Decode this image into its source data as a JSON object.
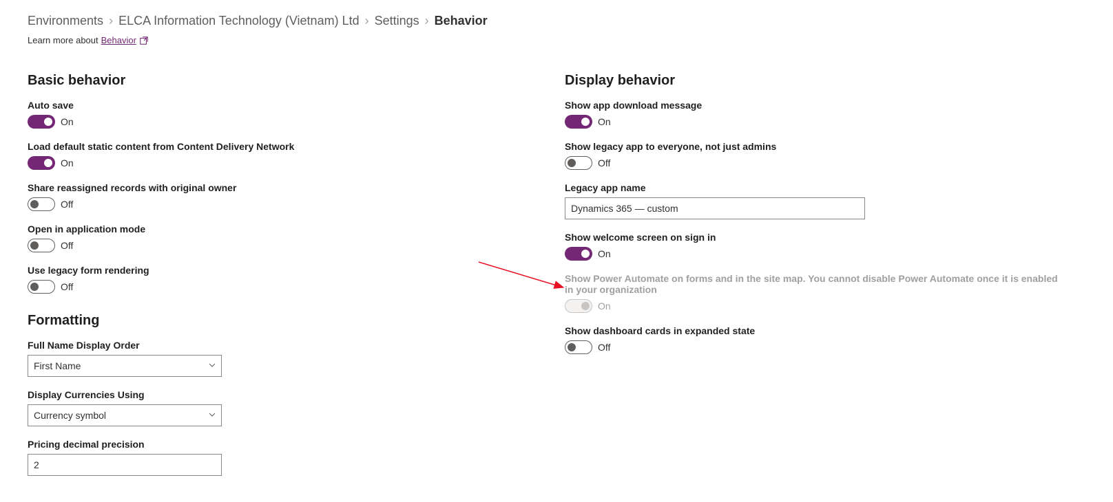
{
  "breadcrumb": {
    "items": [
      "Environments",
      "ELCA Information Technology (Vietnam) Ltd",
      "Settings"
    ],
    "current": "Behavior"
  },
  "learn_more": {
    "prefix": "Learn more about ",
    "link": "Behavior"
  },
  "basic": {
    "title": "Basic behavior",
    "auto_save": {
      "label": "Auto save",
      "state": "On"
    },
    "cdn": {
      "label": "Load default static content from Content Delivery Network",
      "state": "On"
    },
    "share_reassigned": {
      "label": "Share reassigned records with original owner",
      "state": "Off"
    },
    "app_mode": {
      "label": "Open in application mode",
      "state": "Off"
    },
    "legacy_form": {
      "label": "Use legacy form rendering",
      "state": "Off"
    }
  },
  "formatting": {
    "title": "Formatting",
    "full_name": {
      "label": "Full Name Display Order",
      "value": "First Name"
    },
    "currency": {
      "label": "Display Currencies Using",
      "value": "Currency symbol"
    },
    "precision": {
      "label": "Pricing decimal precision",
      "value": "2"
    }
  },
  "display": {
    "title": "Display behavior",
    "download_msg": {
      "label": "Show app download message",
      "state": "On"
    },
    "legacy_app": {
      "label": "Show legacy app to everyone, not just admins",
      "state": "Off"
    },
    "legacy_name": {
      "label": "Legacy app name",
      "value": "Dynamics 365 — custom"
    },
    "welcome": {
      "label": "Show welcome screen on sign in",
      "state": "On"
    },
    "power_automate": {
      "label": "Show Power Automate on forms and in the site map. You cannot disable Power Automate once it is enabled in your organization",
      "state": "On"
    },
    "dashboard_cards": {
      "label": "Show dashboard cards in expanded state",
      "state": "Off"
    }
  }
}
